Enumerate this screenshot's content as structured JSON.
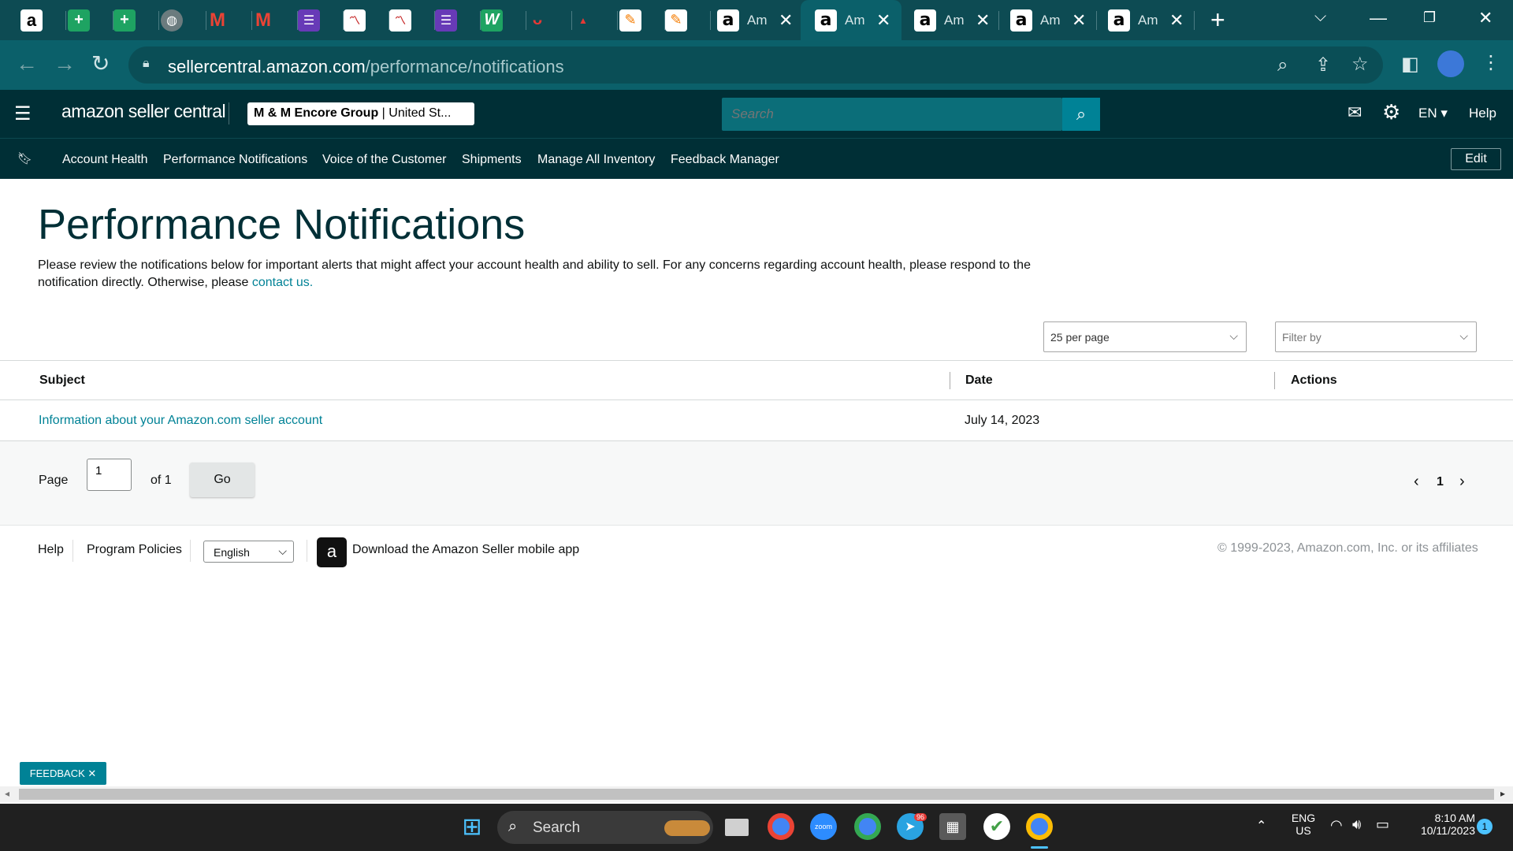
{
  "browser": {
    "tabs": [
      {
        "icon": "amazon-icon",
        "title": ""
      },
      {
        "icon": "sheets-icon",
        "title": ""
      },
      {
        "icon": "sheets-icon",
        "title": ""
      },
      {
        "icon": "globe-icon",
        "title": ""
      },
      {
        "icon": "gmail-icon",
        "title": ""
      },
      {
        "icon": "gmail-icon",
        "title": ""
      },
      {
        "icon": "forms-icon",
        "title": ""
      },
      {
        "icon": "chart-doc-icon",
        "title": ""
      },
      {
        "icon": "chart-doc-icon",
        "title": ""
      },
      {
        "icon": "forms-icon",
        "title": ""
      },
      {
        "icon": "w-app-icon",
        "title": ""
      },
      {
        "icon": "mustache-icon",
        "title": ""
      },
      {
        "icon": "brand-icon",
        "title": ""
      },
      {
        "icon": "pencil-app-icon",
        "title": ""
      },
      {
        "icon": "pencil-app-icon",
        "title": ""
      },
      {
        "icon": "amazon-icon",
        "title": "Am"
      },
      {
        "icon": "amazon-icon",
        "title": "Am"
      },
      {
        "icon": "amazon-icon",
        "title": "Am"
      },
      {
        "icon": "amazon-icon",
        "title": "Am"
      },
      {
        "icon": "amazon-icon",
        "title": "Am"
      }
    ],
    "url_host": "sellercentral.amazon.com",
    "url_path": "/performance/notifications"
  },
  "header": {
    "logo_text": "amazon seller central",
    "account_bold": "M & M Encore Group",
    "account_rest": " | United St...",
    "search_placeholder": "Search",
    "language": "EN",
    "help": "Help"
  },
  "nav": {
    "items": [
      "Account Health",
      "Performance Notifications",
      "Voice of the Customer",
      "Shipments",
      "Manage All Inventory",
      "Feedback Manager"
    ],
    "edit": "Edit"
  },
  "main": {
    "title": "Performance Notifications",
    "intro_text": "Please review the notifications below for important alerts that might affect your account health and ability to sell. For any concerns regarding account health, please respond to the notification directly. Otherwise, please ",
    "intro_link": "contact us.",
    "per_page": "25 per page",
    "filter_placeholder": "Filter by"
  },
  "table": {
    "headers": {
      "subject": "Subject",
      "date": "Date",
      "actions": "Actions"
    },
    "rows": [
      {
        "subject": "Information about your Amazon.com seller account",
        "date": "July 14, 2023",
        "actions": ""
      }
    ]
  },
  "pager": {
    "page_label": "Page",
    "page_value": "1",
    "of_label": "of 1",
    "go": "Go",
    "current": "1"
  },
  "footer": {
    "help": "Help",
    "policies": "Program Policies",
    "language": "English",
    "app_text": "Download the Amazon Seller mobile app",
    "copyright": "© 1999-2023, Amazon.com, Inc. or its affiliates"
  },
  "feedback": "FEEDBACK",
  "taskbar": {
    "search": "Search",
    "lang_1": "ENG",
    "lang_2": "US",
    "time": "8:10 AM",
    "date": "10/11/2023",
    "telegram_badge": "96",
    "notification_count": "1"
  },
  "colors": {
    "header_bg": "#002f36",
    "accent": "#008296",
    "tabbar_bg": "#0d4b53"
  }
}
